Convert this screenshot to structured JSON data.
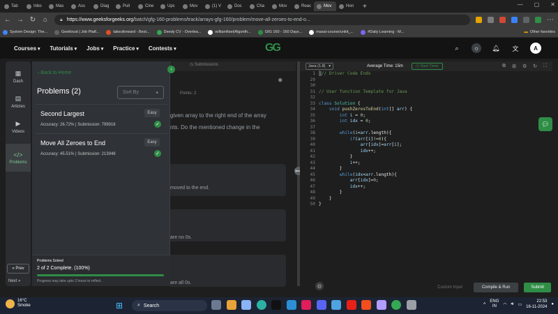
{
  "browser": {
    "tabs": [
      {
        "label": "Tab",
        "active": false
      },
      {
        "label": "Inbo",
        "active": false
      },
      {
        "label": "Mas",
        "active": false
      },
      {
        "label": "Ass",
        "active": false
      },
      {
        "label": "Diag",
        "active": false
      },
      {
        "label": "Pull",
        "active": false
      },
      {
        "label": "Cine",
        "active": false
      },
      {
        "label": "Upc",
        "active": false
      },
      {
        "label": "Mov",
        "active": false
      },
      {
        "label": "(1) V",
        "active": false
      },
      {
        "label": "Doc",
        "active": false
      },
      {
        "label": "Cha",
        "active": false
      },
      {
        "label": "Mov",
        "active": false
      },
      {
        "label": "Reac",
        "active": false
      },
      {
        "label": "Mov",
        "active": true
      },
      {
        "label": "Hon",
        "active": false
      }
    ],
    "new_tab": "+",
    "url_host": "https://www.geeksforgeeks.org",
    "url_path": "/batch/gfg-160-problems/track/arrays-gfg-160/problem/move-all-zeroes-to-end-o...",
    "bookmarks": [
      "System Design: The...",
      "Geektrust | Job Platf...",
      "takeuforward - Best...",
      "Deedy CV - Overlea...",
      "williamfiset/Algorith...",
      "GfG 160 - 160 Days...",
      "masai-course/unkit_...",
      "#Daily Learning - M..."
    ],
    "other_favorites": "Other favorites"
  },
  "site": {
    "logo": "GG",
    "menu": [
      "Courses",
      "Tutorials",
      "Jobs",
      "Practice",
      "Contests"
    ],
    "avatar": "A"
  },
  "rail": {
    "items": [
      {
        "label": "Dash",
        "icon": "grid-icon"
      },
      {
        "label": "Articles",
        "icon": "book-icon"
      },
      {
        "label": "Videos",
        "icon": "play-icon"
      },
      {
        "label": "Problems",
        "icon": "code-icon"
      }
    ],
    "prev": "« Prev",
    "next": "Next »"
  },
  "drawer": {
    "back": "Back to Home",
    "title": "Problems (2)",
    "sort_placeholder": "Sort By",
    "problems": [
      {
        "title": "Second Largest",
        "difficulty": "Easy",
        "meta": "Accuracy: 26.72% | Submission: 799916"
      },
      {
        "title": "Move All Zeroes to End",
        "difficulty": "Easy",
        "meta": "Accuracy: 45.51% | Submission: 213948"
      }
    ],
    "solved_label": "Problems Solved",
    "solved_count": "2 of 2 Complete. (100%)",
    "solved_note": "Progress may take upto 2 hours to reflect.",
    "progress": 1.0
  },
  "problem": {
    "submissions_tab": "Submissions",
    "points": "Points: 2",
    "text_line1": "given array to the right end of the array",
    "text_line2": "nts. Do the mentioned change in the",
    "box1": "moved  to  the  end.",
    "box2": "are  no  0s.",
    "box3": "are  all  0s."
  },
  "editor": {
    "language": "Java (1.8)",
    "avg_time": "Average Time: 15m",
    "start_timer": "Start Timer",
    "line_numbers": [
      "1",
      "29",
      "30",
      "31",
      "32",
      "33",
      "34",
      "35",
      "36",
      "37",
      "38",
      "39",
      "40",
      "41",
      "42",
      "43",
      "44",
      "45",
      "46",
      "47",
      "48",
      "49",
      "50"
    ],
    "custom_input": "Custom Input",
    "compile_run": "Compile & Run",
    "submit": "Submit"
  },
  "taskbar": {
    "temp": "16°C",
    "weather": "Smoke",
    "search": "Search",
    "lang_top": "ENG",
    "lang_bottom": "IN",
    "time": "22:53",
    "date": "16-11-2024"
  }
}
